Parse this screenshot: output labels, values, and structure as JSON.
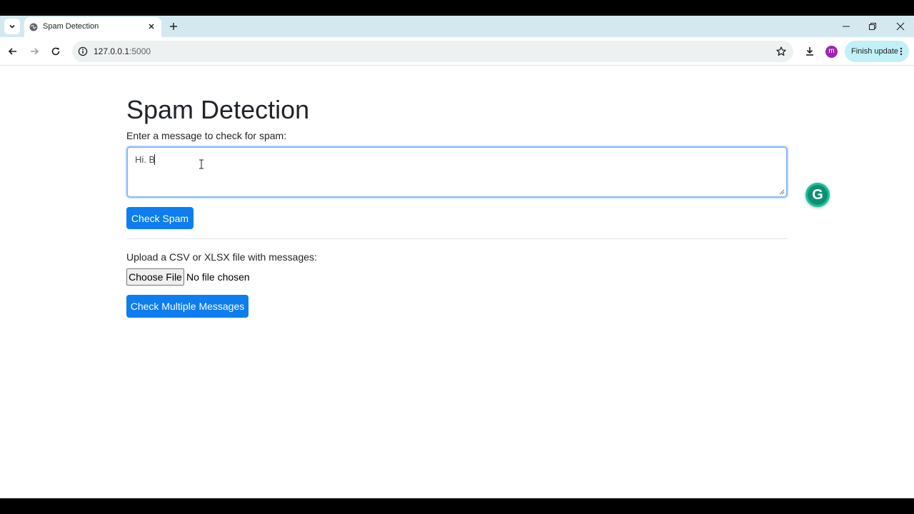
{
  "browser": {
    "tab_title": "Spam Detection",
    "url_host": "127.0.0.1",
    "url_port": ":5000",
    "profile_initial": "m",
    "finish_update_label": "Finish update"
  },
  "page": {
    "heading": "Spam Detection",
    "message_label": "Enter a message to check for spam:",
    "message_value": "Hi. B",
    "check_button": "Check Spam",
    "upload_label": "Upload a CSV or XLSX file with messages:",
    "choose_file_button": "Choose File",
    "no_file_text": "No file chosen",
    "check_multiple_button": "Check Multiple Messages"
  },
  "colors": {
    "accent": "#0d7df0",
    "tabstrip": "#d3e9ef",
    "grammarly": "#15c39a"
  },
  "icons": [
    "tab-search-icon",
    "globe-icon",
    "close-icon",
    "plus-icon",
    "minimize-icon",
    "restore-icon",
    "back-arrow-icon",
    "forward-arrow-icon",
    "reload-icon",
    "info-icon",
    "star-icon",
    "download-icon",
    "more-vert-icon",
    "grammarly-icon"
  ]
}
